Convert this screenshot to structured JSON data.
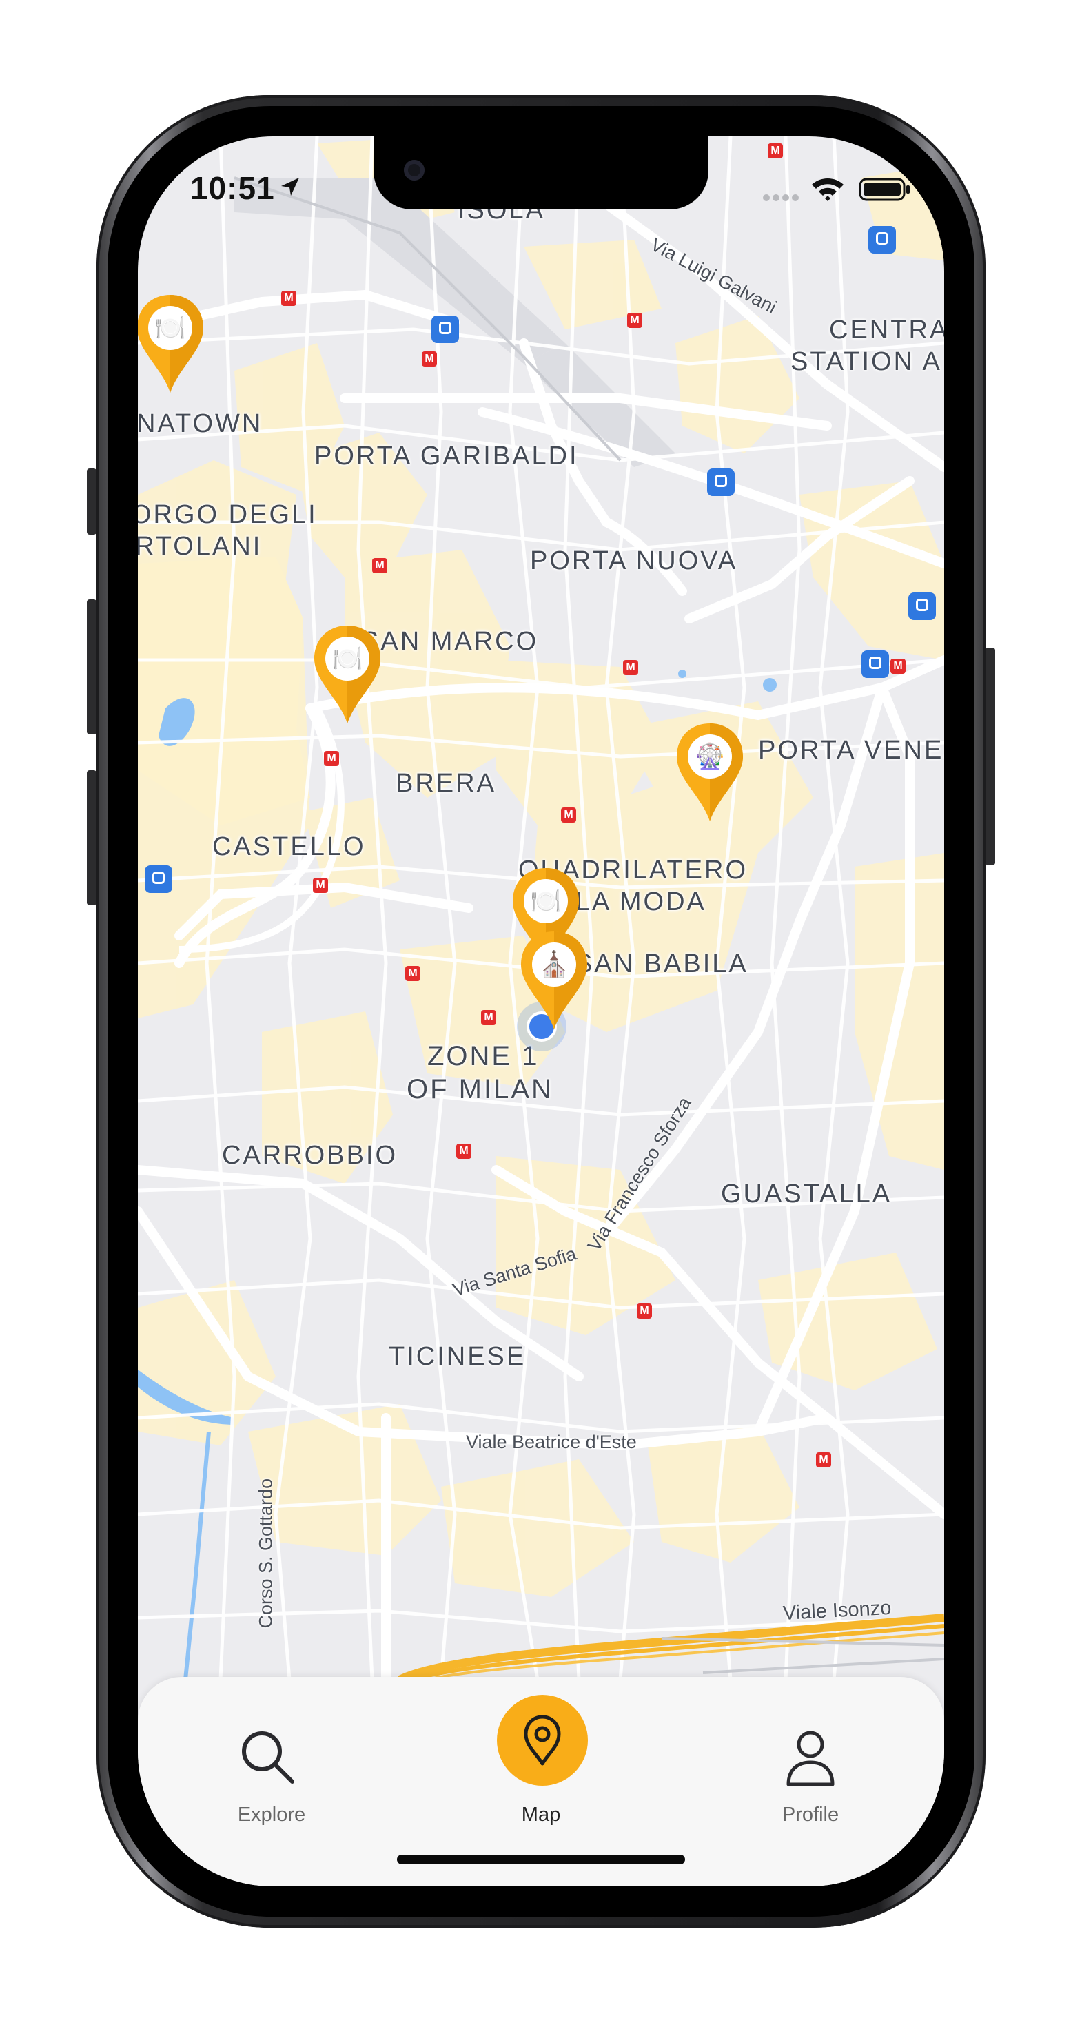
{
  "status_bar": {
    "time": "10:51",
    "location_icon": "location-arrow-icon",
    "signal_icon": "cellular-dots-icon",
    "wifi_icon": "wifi-icon",
    "battery_icon": "battery-icon"
  },
  "map": {
    "area_labels": {
      "isola": "ISOLA",
      "centrale_1": "CENTRA",
      "centrale_2": "STATION A",
      "chinatown": "NATOWN",
      "porta_garibaldi": "PORTA GARIBALDI",
      "borgo_1": "ORGO DEGLI",
      "borgo_2": "RTOLANI",
      "porta_nuova": "PORTA NUOVA",
      "san_marco": "SAN MARCO",
      "brera": "BRERA",
      "porta_venezia": "PORTA VENEZ",
      "castello": "CASTELLO",
      "quadrilatero_1": "QUADRILATERO",
      "quadrilatero_2": "DELLA MODA",
      "san_babila": "SAN BABILA",
      "zone1_1": "ZONE 1",
      "zone1_2": "OF MILAN",
      "carrobbio": "CARROBBIO",
      "guastalla": "GUASTALLA",
      "ticinese": "TICINESE"
    },
    "street_labels": {
      "galvani": "Via Luigi Galvani",
      "sforza": "Via Francesco Sforza",
      "santa_sofia": "Via Santa Sofia",
      "beatrice": "Viale Beatrice d'Este",
      "gottardo": "Corso S. Gottardo",
      "isonzo": "Viale Isonzo"
    },
    "metro_glyph": "M",
    "pins": [
      {
        "name": "restaurant-pin",
        "emoji": "🍽️"
      },
      {
        "name": "restaurant-pin",
        "emoji": "🍽️"
      },
      {
        "name": "attraction-pin",
        "emoji": "🎡"
      },
      {
        "name": "restaurant-pin",
        "emoji": "🍽️"
      },
      {
        "name": "landmark-pin",
        "emoji": "⛪"
      }
    ],
    "colors": {
      "map_bg": "#ececef",
      "building_highlight": "#fdf2cc",
      "road": "#ffffff",
      "highway": "#f6b62b",
      "water": "#8ec2f5",
      "pin": "#f9ad18",
      "user_location": "#3d7dea"
    }
  },
  "tab_bar": {
    "tabs": [
      {
        "label": "Explore",
        "icon": "search-icon"
      },
      {
        "label": "Map",
        "icon": "map-pin-icon"
      },
      {
        "label": "Profile",
        "icon": "person-icon"
      }
    ],
    "active": "Map",
    "active_color": "#f9ad18"
  }
}
